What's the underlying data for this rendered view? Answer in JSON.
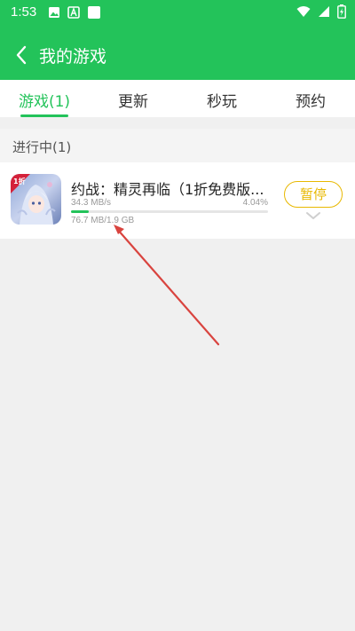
{
  "status_bar": {
    "time": "1:53",
    "icons": [
      "image-icon",
      "a-badge-icon",
      "square-icon",
      "wifi-icon",
      "signal-icon",
      "battery-charging-icon"
    ]
  },
  "header": {
    "title": "我的游戏",
    "back_icon": "chevron-left-icon"
  },
  "tabs": [
    {
      "label": "游戏(1)",
      "active": true
    },
    {
      "label": "更新",
      "active": false
    },
    {
      "label": "秒玩",
      "active": false
    },
    {
      "label": "预约",
      "active": false
    }
  ],
  "section": {
    "title": "进行中(1)"
  },
  "download": {
    "name": "约战：精灵再临（1折免费版...",
    "speed": "34.3 MB/s",
    "percent": "4.04%",
    "progress": 0.0404,
    "size": "76.7 MB/1.9 GB",
    "icon_badge": "1折",
    "pause_label": "暂停"
  },
  "colors": {
    "accent": "#23c35a",
    "pause": "#e8b800",
    "annotation": "#d9443f"
  }
}
